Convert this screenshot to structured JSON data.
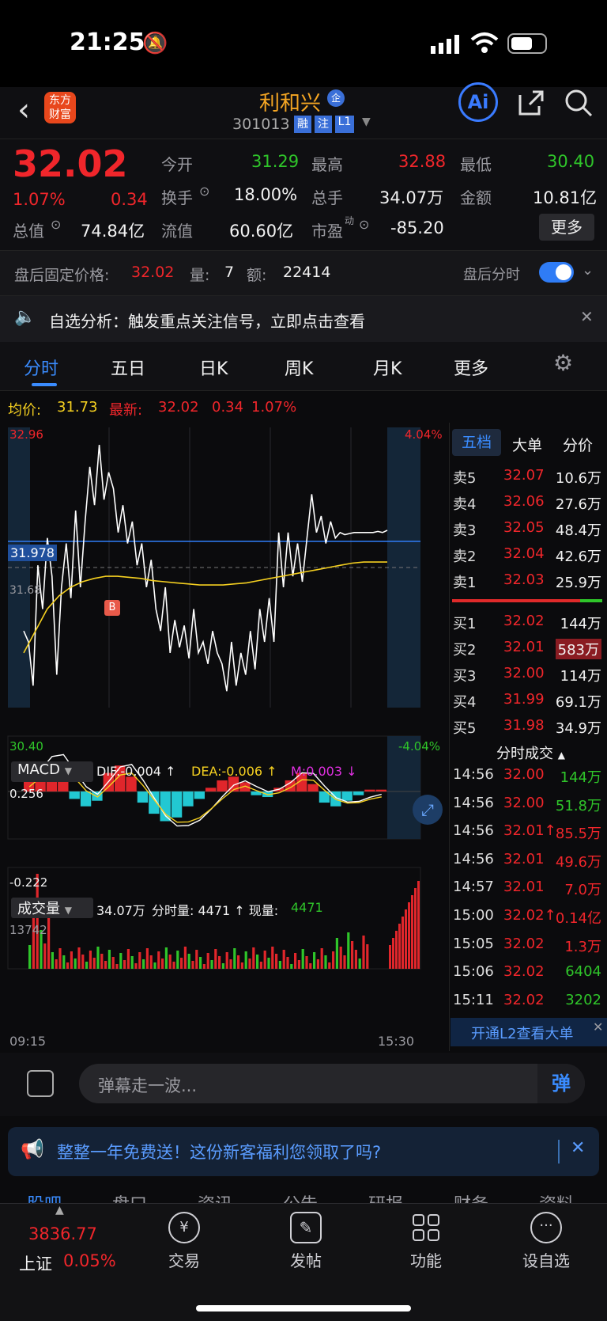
{
  "status": {
    "time": "21:25"
  },
  "header": {
    "logo_line1": "东方",
    "logo_line2": "财富",
    "stock_name": "利和兴",
    "badge_qi": "企",
    "code": "301013",
    "tag_rong": "融",
    "tag_zhu": "注",
    "tag_l1": "L1",
    "ai_label": "Ai"
  },
  "quote": {
    "price": "32.02",
    "pct": "1.07%",
    "change": "0.34",
    "open_label": "今开",
    "open": "31.29",
    "high_label": "最高",
    "high": "32.88",
    "low_label": "最低",
    "low": "30.40",
    "turnover_label": "换手",
    "turnover": "18.00%",
    "volume_label": "总手",
    "volume": "34.07万",
    "amount_label": "金额",
    "amount": "10.81亿",
    "mcap_label": "总值",
    "mcap": "74.84亿",
    "float_label": "流值",
    "float": "60.60亿",
    "pe_label": "市盈",
    "pe_sup": "动",
    "pe": "-85.20",
    "more": "更多"
  },
  "afterhours": {
    "price_label": "盘后固定价格:",
    "price": "32.02",
    "qty_label": "量:",
    "qty": "7",
    "amt_label": "额:",
    "amt": "22414",
    "toggle_label": "盘后分时"
  },
  "notice": {
    "text": "自选分析：触发重点关注信号，立即点击查看"
  },
  "tabs": [
    "分时",
    "五日",
    "日K",
    "周K",
    "月K",
    "更多"
  ],
  "avg": {
    "avg_label": "均价:",
    "avg": "31.73",
    "last_label": "最新:",
    "last": "32.02",
    "chg": "0.34",
    "pct": "1.07%"
  },
  "chart_data": {
    "type": "line",
    "title": "",
    "y_top": "32.96",
    "y_bottom": "30.40",
    "pct_top": "4.04%",
    "pct_bottom": "-4.04%",
    "ref_price": "31.68",
    "cursor_price": "31.978",
    "x_start": "09:15",
    "x_end": "15:30",
    "price_series": [
      31.1,
      31.0,
      30.6,
      31.7,
      31.3,
      31.95,
      31.6,
      30.7,
      31.5,
      31.9,
      31.4,
      32.2,
      31.5,
      32.1,
      32.6,
      32.25,
      32.8,
      32.3,
      32.55,
      32.4,
      32.0,
      32.25,
      31.9,
      32.1,
      31.7,
      31.9,
      31.5,
      31.75,
      31.3,
      31.1,
      31.5,
      30.9,
      31.2,
      30.95,
      31.15,
      30.85,
      31.3,
      30.9,
      31.0,
      30.8,
      31.1,
      30.9,
      30.8,
      30.55,
      31.0,
      30.6,
      30.9,
      30.7,
      31.1,
      30.75,
      31.3,
      31.0,
      31.4,
      31.0,
      32.0,
      31.5,
      32.0,
      31.6,
      31.9,
      31.55,
      31.95,
      32.35,
      32.0,
      32.15,
      31.9,
      32.1,
      31.95,
      32.0,
      31.98,
      31.99,
      32.0,
      32.0,
      32.0,
      32.0,
      32.0,
      32.01,
      32.0,
      32.02
    ],
    "avg_series": [
      30.9,
      31.1,
      31.3,
      31.42,
      31.5,
      31.55,
      31.58,
      31.6,
      31.6,
      31.59,
      31.58,
      31.56,
      31.55,
      31.54,
      31.53,
      31.52,
      31.52,
      31.52,
      31.53,
      31.54,
      31.56,
      31.58,
      31.6,
      31.62,
      31.64,
      31.66,
      31.68,
      31.7,
      31.72,
      31.73,
      31.73,
      31.73
    ],
    "macd_label": "MACD",
    "dif_label": "DIF:-0.004 ↑",
    "dea_label": "DEA:-0.006 ↑",
    "m_label": "M:0.003 ↓",
    "macd_top": "0.256",
    "macd_bottom": "-0.222",
    "macd_hist": [
      0.08,
      0.12,
      0.16,
      0.1,
      -0.04,
      -0.08,
      -0.05,
      0.1,
      0.14,
      0.08,
      -0.06,
      -0.12,
      -0.16,
      -0.14,
      -0.08,
      -0.04,
      0.02,
      0.06,
      0.08,
      0.05,
      -0.02,
      -0.03,
      0.02,
      0.06,
      0.1,
      0.04,
      -0.06,
      -0.08,
      -0.05,
      -0.02,
      0.01,
      0.01
    ],
    "vol_label": "成交量",
    "vol_total": "34.07万",
    "vol_info": "分时量: 4471 ↑ 现量:",
    "vol_now": "4471",
    "vol_top": "13742"
  },
  "orderbook": {
    "tabs": [
      "五档",
      "大单",
      "分价"
    ],
    "asks": [
      {
        "label": "卖5",
        "price": "32.07",
        "vol": "10.6万"
      },
      {
        "label": "卖4",
        "price": "32.06",
        "vol": "27.6万"
      },
      {
        "label": "卖3",
        "price": "32.05",
        "vol": "48.4万"
      },
      {
        "label": "卖2",
        "price": "32.04",
        "vol": "42.6万"
      },
      {
        "label": "卖1",
        "price": "32.03",
        "vol": "25.9万"
      }
    ],
    "bids": [
      {
        "label": "买1",
        "price": "32.02",
        "vol": "144万"
      },
      {
        "label": "买2",
        "price": "32.01",
        "vol": "583万"
      },
      {
        "label": "买3",
        "price": "32.00",
        "vol": "114万"
      },
      {
        "label": "买4",
        "price": "31.99",
        "vol": "69.1万"
      },
      {
        "label": "买5",
        "price": "31.98",
        "vol": "34.9万"
      }
    ],
    "trades_title": "分时成交",
    "trades": [
      {
        "t": "14:56",
        "p": "32.00",
        "v": "144万"
      },
      {
        "t": "14:56",
        "p": "32.00",
        "v": "51.8万"
      },
      {
        "t": "14:56",
        "p": "32.01↑",
        "v": "85.5万"
      },
      {
        "t": "14:56",
        "p": "32.01",
        "v": "49.6万"
      },
      {
        "t": "14:57",
        "p": "32.01",
        "v": "7.0万"
      },
      {
        "t": "15:00",
        "p": "32.02↑",
        "v": "0.14亿"
      },
      {
        "t": "15:05",
        "p": "32.02",
        "v": "1.3万"
      },
      {
        "t": "15:06",
        "p": "32.02",
        "v": "6404"
      },
      {
        "t": "15:11",
        "p": "32.02",
        "v": "3202"
      }
    ],
    "l2_banner": "开通L2查看大单"
  },
  "comment": {
    "placeholder": "弹幕走一波...",
    "send": "弹"
  },
  "promo": {
    "text": "整整一年免费送！这份新客福利您领取了吗?"
  },
  "peek_tabs": [
    "股吧",
    "盘口",
    "资讯",
    "公告",
    "研报",
    "财务",
    "资料"
  ],
  "bottom_nav": {
    "index_value": "3836.77",
    "index_name": "上证",
    "index_pct": "0.05%",
    "items": [
      "交易",
      "发帖",
      "功能",
      "设自选"
    ]
  }
}
